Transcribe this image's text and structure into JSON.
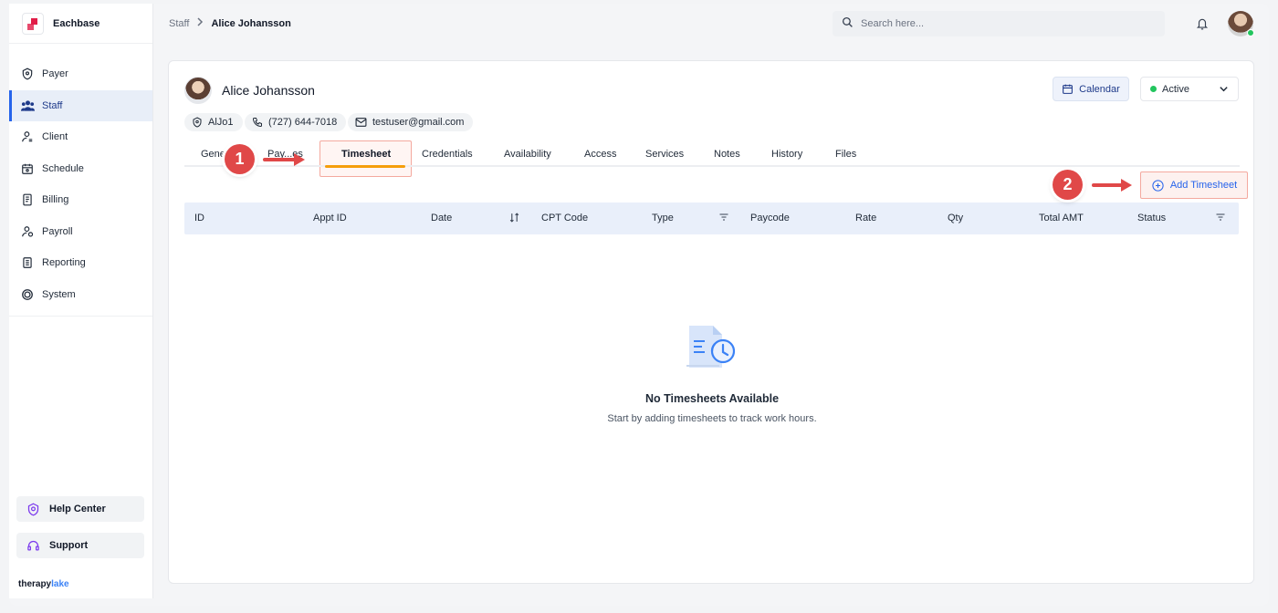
{
  "app": {
    "name": "Eachbase",
    "brand_left": "therapy",
    "brand_right": "lake"
  },
  "sidebar": {
    "items": [
      {
        "label": "Payer",
        "icon": "shield-icon"
      },
      {
        "label": "Staff",
        "icon": "users-icon",
        "active": true
      },
      {
        "label": "Client",
        "icon": "user-icon"
      },
      {
        "label": "Schedule",
        "icon": "calendar-icon"
      },
      {
        "label": "Billing",
        "icon": "billing-icon"
      },
      {
        "label": "Payroll",
        "icon": "payroll-icon"
      },
      {
        "label": "Reporting",
        "icon": "report-icon"
      },
      {
        "label": "System",
        "icon": "system-icon"
      }
    ],
    "help_label": "Help Center",
    "support_label": "Support"
  },
  "header": {
    "breadcrumb_parent": "Staff",
    "breadcrumb_current": "Alice Johansson",
    "search_placeholder": "Search here..."
  },
  "profile": {
    "name": "Alice Johansson",
    "code": "AlJo1",
    "phone": "(727) 644-7018",
    "email": "testuser@gmail.com",
    "calendar_label": "Calendar",
    "status_value": "Active"
  },
  "tabs": [
    "Gene",
    "Pay...es",
    "Timesheet",
    "Credentials",
    "Availability",
    "Access",
    "Services",
    "Notes",
    "History",
    "Files"
  ],
  "active_tab": "Timesheet",
  "add_button_label": "Add Timesheet",
  "table": {
    "columns": [
      "ID",
      "Appt ID",
      "Date",
      "CPT Code",
      "Type",
      "Paycode",
      "Rate",
      "Qty",
      "Total AMT",
      "Status"
    ]
  },
  "empty": {
    "title": "No Timesheets Available",
    "subtitle": "Start by adding timesheets to track work hours."
  },
  "callouts": [
    "1",
    "2"
  ],
  "colors": {
    "accent": "#2563eb",
    "tab_underline": "#f59e0b",
    "callout": "#e04848",
    "status_dot": "#22c55e"
  }
}
